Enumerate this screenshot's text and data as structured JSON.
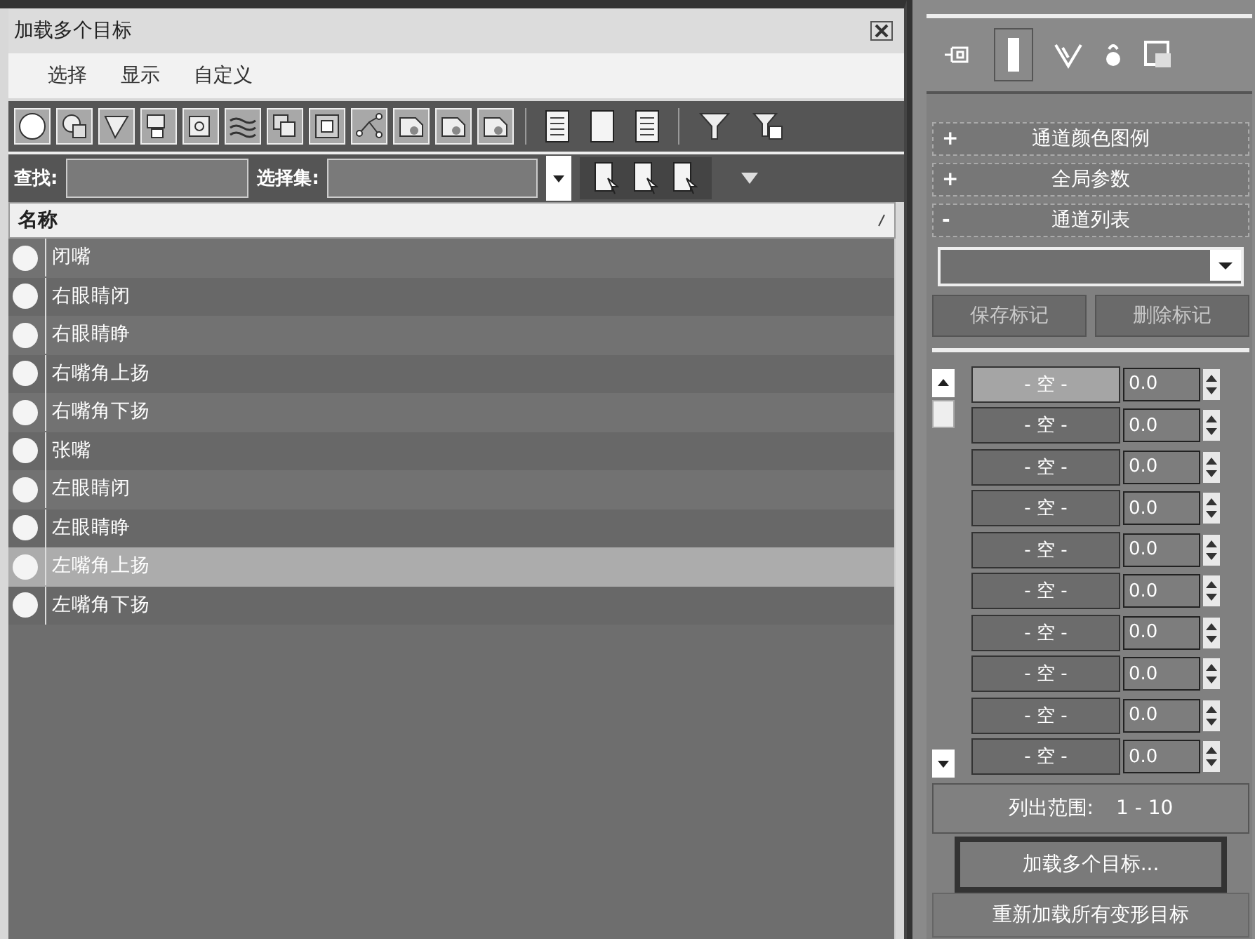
{
  "dialog": {
    "title": "加载多个目标",
    "menu": [
      "选择",
      "显示",
      "自定义"
    ],
    "find_label": "查找:",
    "selection_set_label": "选择集:",
    "column": "名称",
    "rows": [
      {
        "name": "闭嘴",
        "selected": false
      },
      {
        "name": "右眼睛闭",
        "selected": false
      },
      {
        "name": "右眼睛睁",
        "selected": false
      },
      {
        "name": "右嘴角上扬",
        "selected": false
      },
      {
        "name": "右嘴角下扬",
        "selected": false
      },
      {
        "name": "张嘴",
        "selected": false
      },
      {
        "name": "左眼睛闭",
        "selected": false
      },
      {
        "name": "左眼睛睁",
        "selected": false
      },
      {
        "name": "左嘴角上扬",
        "selected": true
      },
      {
        "name": "左嘴角下扬",
        "selected": false
      }
    ]
  },
  "panel": {
    "rollouts": [
      {
        "sign": "+",
        "title": "通道颜色图例"
      },
      {
        "sign": "+",
        "title": "全局参数"
      },
      {
        "sign": "-",
        "title": "通道列表"
      }
    ],
    "buttons": [
      {
        "label": "保存标记",
        "disabled": true
      },
      {
        "label": "删除标记",
        "disabled": true
      }
    ],
    "channels": [
      {
        "name": "- 空 -",
        "value": "0.0",
        "selected": true
      },
      {
        "name": "- 空 -",
        "value": "0.0",
        "selected": false
      },
      {
        "name": "- 空 -",
        "value": "0.0",
        "selected": false
      },
      {
        "name": "- 空 -",
        "value": "0.0",
        "selected": false
      },
      {
        "name": "- 空 -",
        "value": "0.0",
        "selected": false
      },
      {
        "name": "- 空 -",
        "value": "0.0",
        "selected": false
      },
      {
        "name": "- 空 -",
        "value": "0.0",
        "selected": false
      },
      {
        "name": "- 空 -",
        "value": "0.0",
        "selected": false
      },
      {
        "name": "- 空 -",
        "value": "0.0",
        "selected": false
      },
      {
        "name": "- 空 -",
        "value": "0.0",
        "selected": false
      }
    ],
    "range_label": "列出范围:",
    "range": "1 - 10",
    "actions": [
      {
        "label": "加载多个目标...",
        "highlighted": true
      },
      {
        "label": "重新加载所有变形目标",
        "highlighted": false
      }
    ]
  }
}
